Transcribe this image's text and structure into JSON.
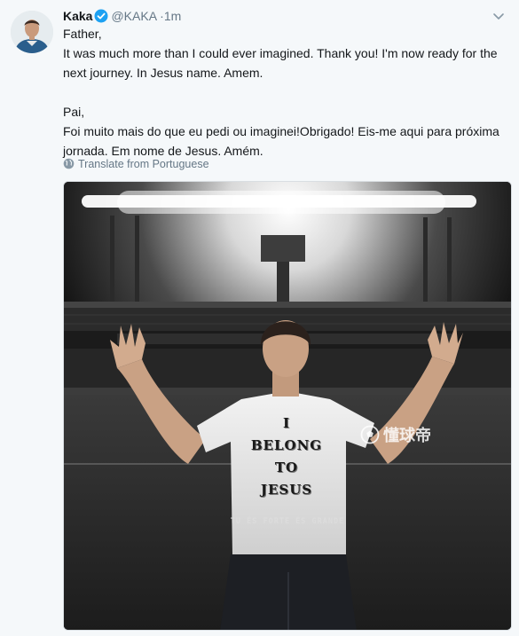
{
  "tweet": {
    "author_name": "Kaka",
    "handle": "@KAKA",
    "separator": "·",
    "time": "1m",
    "verified_color": "#1da1f2",
    "english_lines": [
      "Father,",
      "It was much more than I could ever imagined. Thank you! I'm now ready for the",
      "next journey. In Jesus name. Amem."
    ],
    "portuguese_lines": [
      "Pai,",
      "Foi muito mais do que eu pedi ou imaginei!Obrigado! Eis-me aqui para próxima",
      "jornada. Em nome de Jesus. Amém."
    ],
    "translate_label": "Translate from Portuguese"
  },
  "media": {
    "banner_text": "TU ÉS FORTE  ÉS GRANDE",
    "shirt_lines": [
      "I",
      "BELONG",
      "TO",
      "JESUS"
    ],
    "watermark_text": "懂球帝"
  },
  "icons": {
    "caret": "chevron-down-icon",
    "verified": "verified-badge-icon",
    "translate": "globe-icon",
    "watermark": "soccer-ball-icon"
  }
}
